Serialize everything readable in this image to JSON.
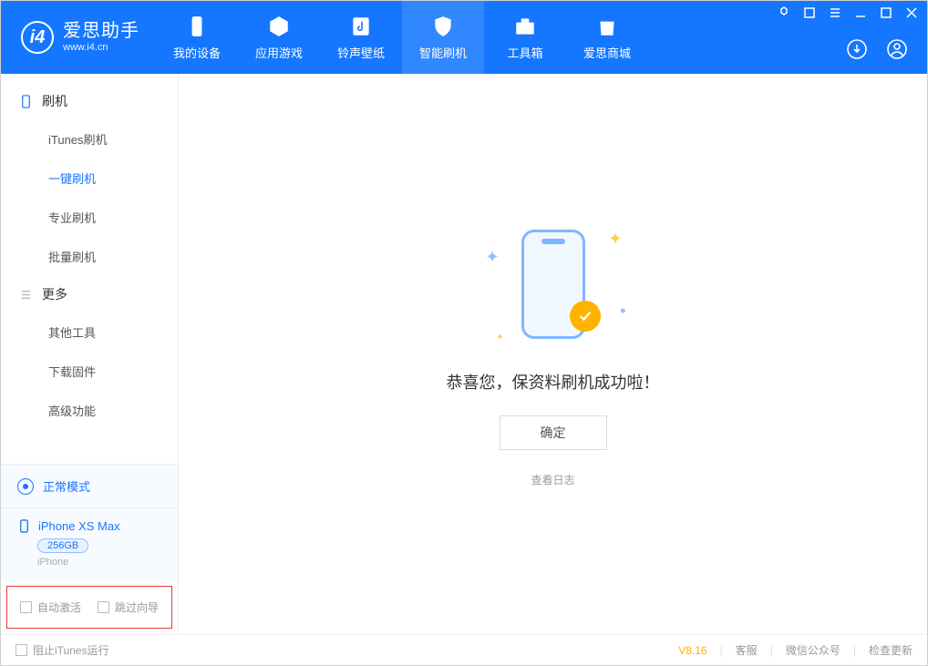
{
  "app": {
    "name_cn": "爱思助手",
    "name_en": "www.i4.cn"
  },
  "nav": {
    "items": [
      {
        "label": "我的设备"
      },
      {
        "label": "应用游戏"
      },
      {
        "label": "铃声壁纸"
      },
      {
        "label": "智能刷机"
      },
      {
        "label": "工具箱"
      },
      {
        "label": "爱思商城"
      }
    ]
  },
  "sidebar": {
    "group_flash": {
      "title": "刷机",
      "items": [
        {
          "label": "iTunes刷机"
        },
        {
          "label": "一键刷机"
        },
        {
          "label": "专业刷机"
        },
        {
          "label": "批量刷机"
        }
      ]
    },
    "group_more": {
      "title": "更多",
      "items": [
        {
          "label": "其他工具"
        },
        {
          "label": "下载固件"
        },
        {
          "label": "高级功能"
        }
      ]
    },
    "mode_label": "正常模式",
    "device": {
      "name": "iPhone XS Max",
      "capacity": "256GB",
      "type": "iPhone"
    },
    "check_auto_activate": "自动激活",
    "check_skip_guide": "跳过向导"
  },
  "main": {
    "success_text": "恭喜您，保资料刷机成功啦！",
    "ok_button": "确定",
    "view_log": "查看日志"
  },
  "footer": {
    "block_itunes": "阻止iTunes运行",
    "version": "V8.16",
    "service": "客服",
    "wechat": "微信公众号",
    "check_update": "检查更新"
  }
}
